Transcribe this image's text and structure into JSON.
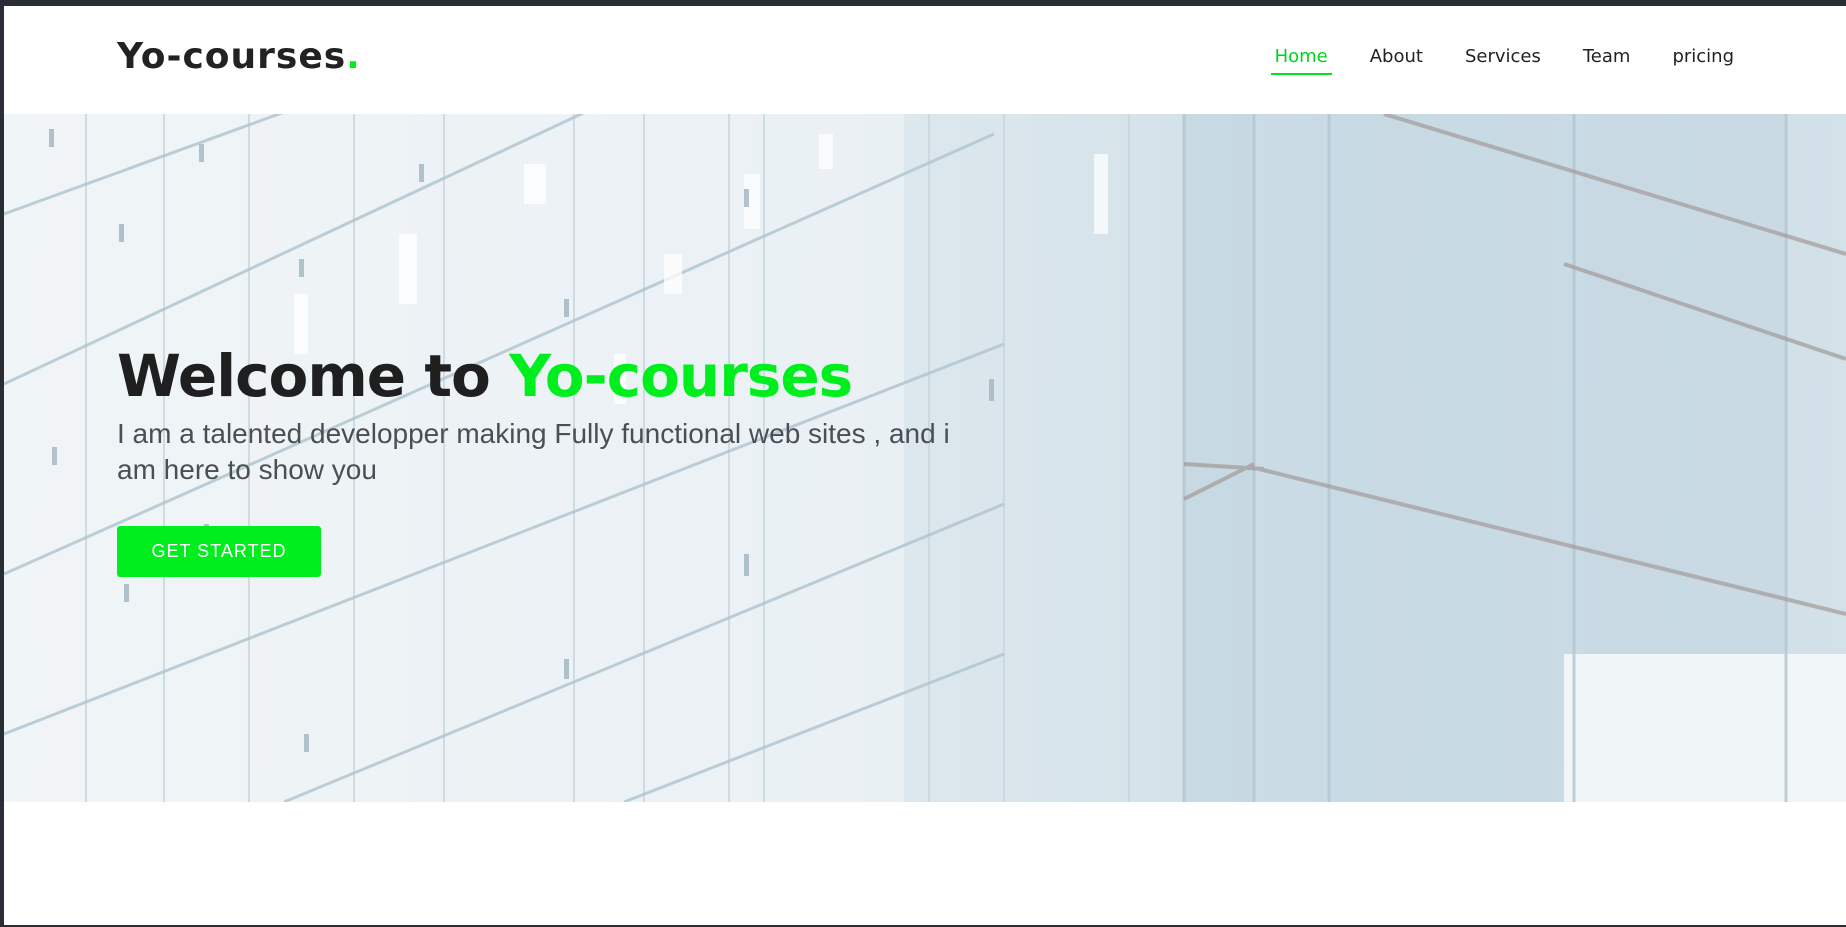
{
  "header": {
    "logo_text": "Yo-courses",
    "logo_dot": ".",
    "nav": [
      {
        "label": "Home",
        "active": true
      },
      {
        "label": "About",
        "active": false
      },
      {
        "label": "Services",
        "active": false
      },
      {
        "label": "Team",
        "active": false
      },
      {
        "label": "pricing",
        "active": false
      }
    ]
  },
  "hero": {
    "title_prefix": "Welcome to ",
    "title_accent": "Yo-courses",
    "subtitle": "I am a talented developper making Fully functional web sites , and i am here to show you",
    "cta_label": "GET STARTED",
    "background_icon": "glass-building-image"
  },
  "colors": {
    "accent": "#00ee1e",
    "text_dark": "#222222",
    "frame": "#2a2d36"
  }
}
